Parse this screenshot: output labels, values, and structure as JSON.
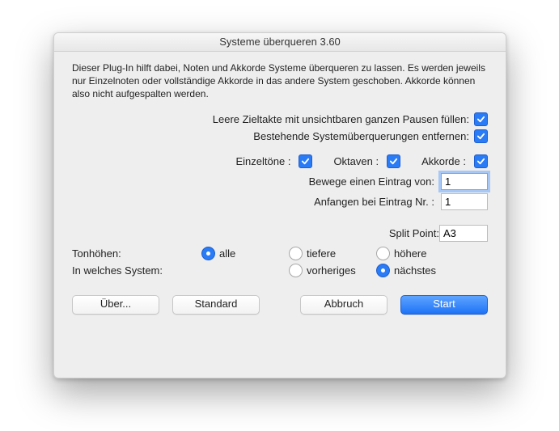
{
  "window": {
    "title": "Systeme überqueren 3.60"
  },
  "description": "Dieser Plug-In hilft dabei, Noten und Akkorde Systeme überqueren zu lassen. Es werden jeweils nur Einzelnoten oder vollständige Akkorde in das andere System geschoben. Akkorde können also nicht aufgespalten werden.",
  "options": {
    "fill_label": "Leere Zieltakte mit unsichtbaren ganzen Pausen füllen:",
    "fill_checked": true,
    "remove_label": "Bestehende Systemüberquerungen entfernen:",
    "remove_checked": true
  },
  "filters": {
    "single_label": "Einzeltöne :",
    "single_checked": true,
    "octaves_label": "Oktaven :",
    "octaves_checked": true,
    "chords_label": "Akkorde :",
    "chords_checked": true
  },
  "move": {
    "step_label": "Bewege einen Eintrag von:",
    "step_value": "1",
    "start_label": "Anfangen bei Eintrag Nr. :",
    "start_value": "1"
  },
  "split": {
    "label": "Split Point:",
    "value": "A3"
  },
  "pitches": {
    "label": "Tonhöhen:",
    "all": "alle",
    "lower": "tiefere",
    "higher": "höhere",
    "selected": "all"
  },
  "target": {
    "label": "In welches System:",
    "prev": "vorheriges",
    "next": "nächstes",
    "selected": "next"
  },
  "buttons": {
    "about": "Über...",
    "default": "Standard",
    "cancel": "Abbruch",
    "start": "Start"
  }
}
